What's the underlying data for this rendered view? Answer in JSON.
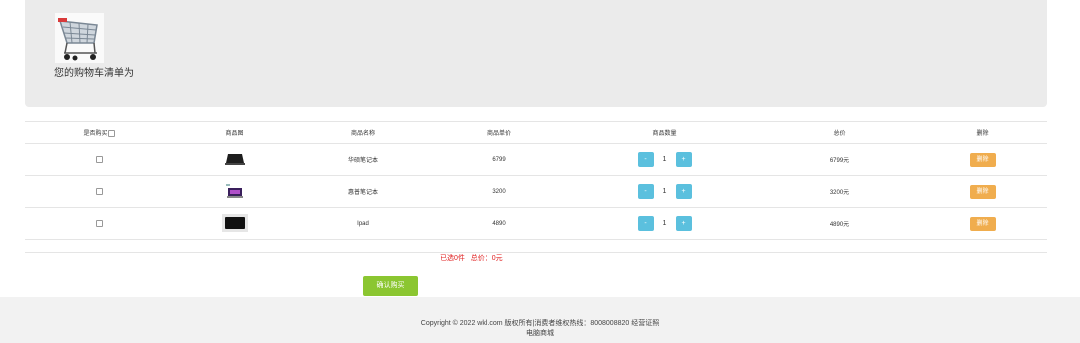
{
  "header": {
    "cart_icon": "shopping-cart-icon",
    "title": "您的购物车清单为",
    "bg_color": "#ebebeb"
  },
  "table": {
    "headers": {
      "select": "是否购买",
      "image": "商品图",
      "name": "商品名称",
      "price": "商品单价",
      "qty": "商品数量",
      "total": "总价",
      "delete": "删除"
    },
    "rows": [
      {
        "name": "华硕笔记本",
        "price": "6799",
        "qty": "1",
        "total": "6799元",
        "minus": "-",
        "plus": "+",
        "delete": "删除"
      },
      {
        "name": "惠普笔记本",
        "price": "3200",
        "qty": "1",
        "total": "3200元",
        "minus": "-",
        "plus": "+",
        "delete": "删除"
      },
      {
        "name": "Ipad",
        "price": "4890",
        "qty": "1",
        "total": "4890元",
        "minus": "-",
        "plus": "+",
        "delete": "删除"
      }
    ]
  },
  "summary": {
    "text": "已选0件   总价：0元"
  },
  "confirm": {
    "label": "确认购买"
  },
  "footer": {
    "line1": "Copyright © 2022 wkl.com 版权所有|消费者维权热线：8008008820 经营证照",
    "line2": "电脑商城"
  },
  "colors": {
    "qty_button": "#5bc0de",
    "delete_button": "#f0ad4e",
    "confirm_button": "#8bc631",
    "summary_text": "#e02020"
  }
}
